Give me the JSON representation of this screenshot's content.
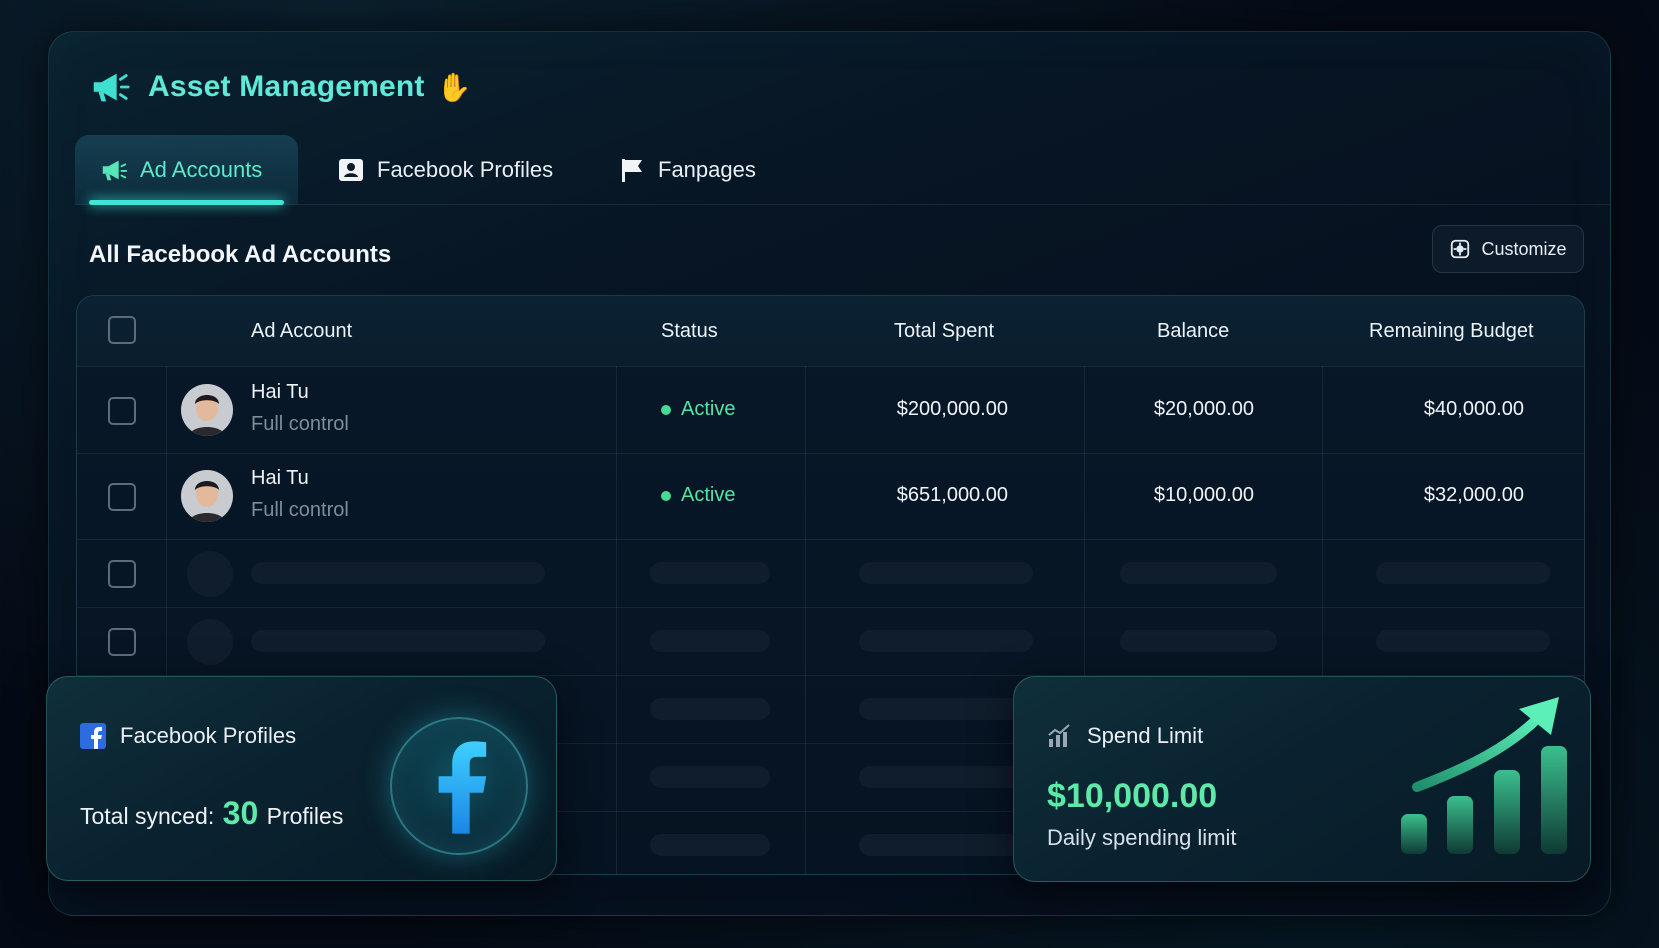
{
  "header": {
    "title": "Asset Management",
    "emoji": "✋"
  },
  "tabs": [
    {
      "label": "Ad Accounts",
      "active": true
    },
    {
      "label": "Facebook Profiles",
      "active": false
    },
    {
      "label": "Fanpages",
      "active": false
    }
  ],
  "section": {
    "title": "All Facebook Ad Accounts",
    "customize_label": "Customize"
  },
  "table": {
    "columns": [
      "Ad Account",
      "Status",
      "Total Spent",
      "Balance",
      "Remaining Budget"
    ],
    "rows": [
      {
        "name": "Hai Tu",
        "role": "Full control",
        "status": "Active",
        "total_spent": "$200,000.00",
        "balance": "$20,000.00",
        "remaining_budget": "$40,000.00"
      },
      {
        "name": "Hai Tu",
        "role": "Full control",
        "status": "Active",
        "total_spent": "$651,000.00",
        "balance": "$10,000.00",
        "remaining_budget": "$32,000.00"
      }
    ]
  },
  "profiles_card": {
    "title": "Facebook Profiles",
    "prefix": "Total synced:",
    "count": "30",
    "suffix": "Profiles"
  },
  "spend_card": {
    "title": "Spend Limit",
    "amount": "$10,000.00",
    "subtitle": "Daily spending limit"
  },
  "colors": {
    "accent": "#5ee9d9",
    "success": "#55e3a3",
    "background": "#050b16"
  },
  "icons": [
    "megaphone-icon",
    "profile-card-icon",
    "flag-icon",
    "customize-icon",
    "facebook-icon",
    "bar-chart-icon"
  ]
}
